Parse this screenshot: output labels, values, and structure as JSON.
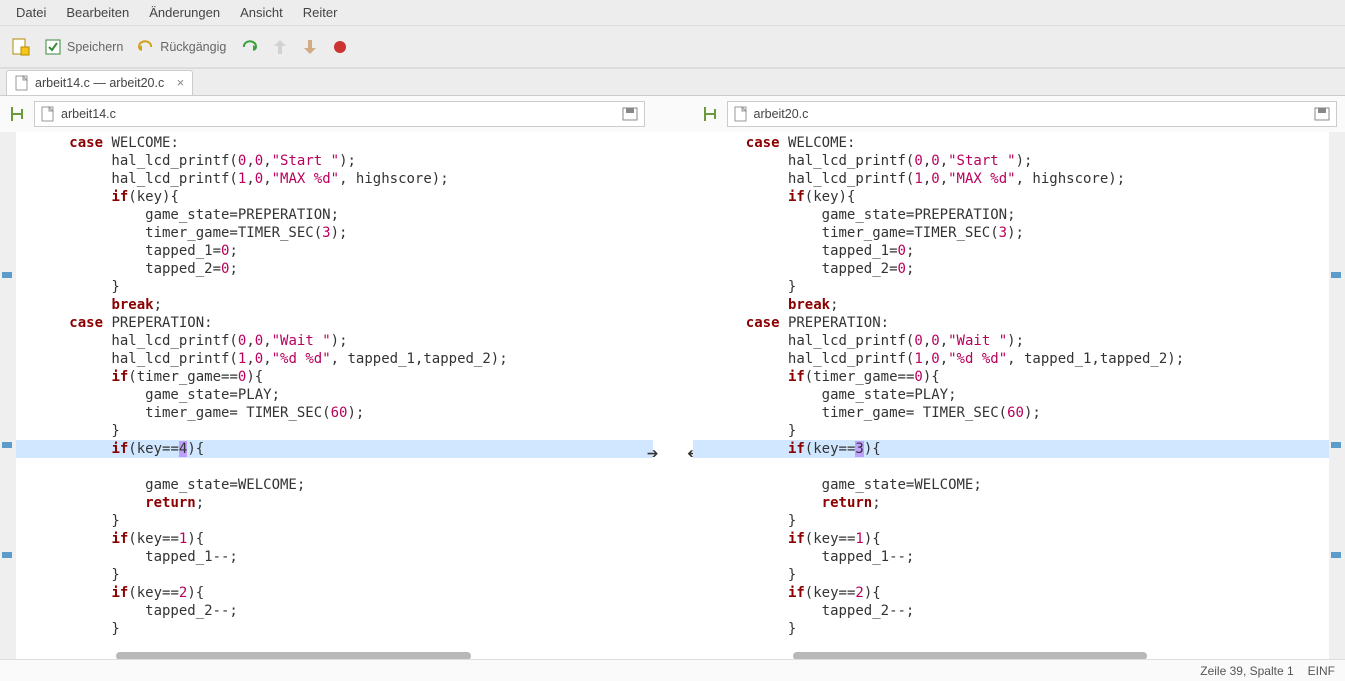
{
  "menu": {
    "file": "Datei",
    "edit": "Bearbeiten",
    "changes": "Änderungen",
    "view": "Ansicht",
    "tabs": "Reiter"
  },
  "toolbar": {
    "save": "Speichern",
    "undo": "Rückgängig"
  },
  "tab": {
    "label": "arbeit14.c — arbeit20.c"
  },
  "left_file": "arbeit14.c",
  "right_file": "arbeit20.c",
  "diff": {
    "left_key": "4",
    "right_key": "3"
  },
  "code": {
    "c_case": "case",
    "c_break": "break",
    "c_if": "if",
    "c_return": "return",
    "welcome": " WELCOME:",
    "preperation": " PREPERATION:",
    "hal": "hal_lcd_printf",
    "start": "\"Start \"",
    "max": "\"MAX %d\"",
    "wait": "\"Wait \"",
    "dd": "\"%d %d\"",
    "highscore": ", highscore);",
    "key": "(key){",
    "gs_prep": "game_state=PREPERATION;",
    "tg3": "timer_game=TIMER_SEC(",
    "n3": "3",
    "close_p": ");",
    "t1": "tapped_1=",
    "t2": "tapped_2=",
    "n0": "0",
    "semi": ";",
    "rbrace": "}",
    "tg0": "(timer_game==",
    "close_b": "){",
    "gs_play": "game_state=PLAY;",
    "tg60a": "timer_game= TIMER_SEC(",
    "n60": "60",
    "tapped12": ", tapped_1,tapped_2);",
    "keyeq": "(key==",
    "gs_welcome": "game_state=WELCOME;",
    "n1": "1",
    "n2": "2",
    "t1dec": "tapped_1--;",
    "t2dec": "tapped_2--;",
    "p00": "(",
    "c0": "0",
    "c1": "1",
    "comma": ","
  },
  "status": {
    "pos": "Zeile 39, Spalte 1",
    "mode": "EINF"
  }
}
